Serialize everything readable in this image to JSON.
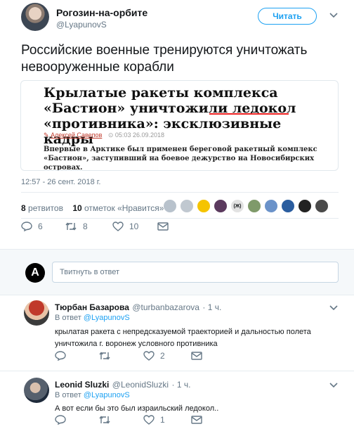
{
  "tweet": {
    "author_name": "Рогозин-на-орбите",
    "author_handle": "@LyapunovS",
    "follow_label": "Читать",
    "text": "Российские военные тренируются уничтожать невооруженные корабли",
    "timestamp": "12:57 - 26 сент. 2018 г.",
    "retweets_count": "8",
    "retweets_label": "ретвитов",
    "likes_count": "10",
    "likes_label": "отметок «Нравится»",
    "reply_count": "6",
    "retweet_action_count": "8",
    "like_action_count": "10"
  },
  "card": {
    "title_part1": "Крылатые ракеты комплекса «Бастион» уничтожили ",
    "title_highlight": "ледокол",
    "title_part2": " «противника»: эксклюзивные кадры",
    "author": "Алексей Савепов",
    "date": "05:03 26.09.2018",
    "lead": "Впервые в Арктике был применен береговой ракетный комплекс «Бастион», заступивший на боевое дежурство на Новосибирских островах."
  },
  "reply_box": {
    "placeholder": "Твитнуть в ответ",
    "avatar_glyph": "A"
  },
  "likers": [
    {
      "color": "#b8c2cc"
    },
    {
      "color": "#c0c8d0"
    },
    {
      "color": "#f5c400"
    },
    {
      "color": "#5b3a5e"
    },
    {
      "color": "#e2e2e2",
      "text": "(Ж)"
    },
    {
      "color": "#7f9a6a"
    },
    {
      "color": "#6a92c9"
    },
    {
      "color": "#2a5d9f"
    },
    {
      "color": "#222"
    },
    {
      "color": "#4a4a4a"
    }
  ],
  "replies": [
    {
      "name": "Тюрбан Базарова",
      "handle": "@turbanbazarova",
      "time": "· 1 ч.",
      "in_reply_label": "В ответ",
      "in_reply_to": "@LyapunovS",
      "text": "крылатая ракета с непредсказуемой траекторией и дальностью полета уничтожила г. воронеж условного противника",
      "reply_count": "",
      "retweet_count": "",
      "like_count": "2"
    },
    {
      "name": "Leonid Sluzki",
      "handle": "@LeonidSluzki",
      "time": "· 1 ч.",
      "in_reply_label": "В ответ",
      "in_reply_to": "@LyapunovS",
      "text": "А вот если бы это был израильский ледокол..",
      "reply_count": "",
      "retweet_count": "",
      "like_count": "1"
    }
  ],
  "colors": {
    "accent": "#1da1f2",
    "muted": "#657786",
    "highlight_underline": "#e22"
  }
}
